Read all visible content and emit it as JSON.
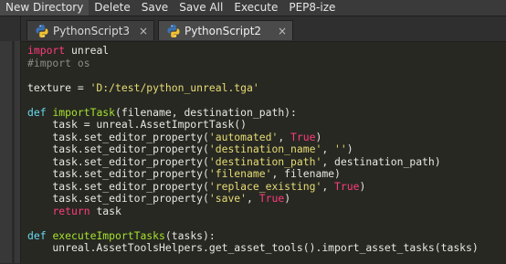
{
  "toolbar": {
    "items": [
      "New Directory",
      "Delete",
      "Save",
      "Save All",
      "Execute",
      "PEP8-ize"
    ]
  },
  "tabs": [
    {
      "label": "PythonScript3",
      "active": false,
      "close": "×"
    },
    {
      "label": "PythonScript2",
      "active": true,
      "close": "×"
    }
  ],
  "colors": {
    "keyword": "#ff3b7e",
    "string": "#e6db74",
    "comment": "#8b8b84",
    "def_keyword": "#66d9ef",
    "function_name": "#a6e22e",
    "editor_bg": "#272822",
    "default_text": "#e8e8e2"
  },
  "code": {
    "lines": [
      [
        [
          "kw",
          "import"
        ],
        [
          "t",
          " unreal"
        ]
      ],
      [
        [
          "com",
          "#import os"
        ]
      ],
      [],
      [
        [
          "t",
          "texture = "
        ],
        [
          "str",
          "'D:/test/python_unreal.tga'"
        ]
      ],
      [],
      [
        [
          "def",
          "def"
        ],
        [
          "t",
          " "
        ],
        [
          "fn",
          "importTask"
        ],
        [
          "t",
          "(filename, destination_path):"
        ]
      ],
      [
        [
          "t",
          "    task = unreal.AssetImportTask()"
        ]
      ],
      [
        [
          "t",
          "    task.set_editor_property("
        ],
        [
          "str",
          "'automated'"
        ],
        [
          "t",
          ", "
        ],
        [
          "bool",
          "True"
        ],
        [
          "t",
          ")"
        ]
      ],
      [
        [
          "t",
          "    task.set_editor_property("
        ],
        [
          "str",
          "'destination_name'"
        ],
        [
          "t",
          ", "
        ],
        [
          "str",
          "''"
        ],
        [
          "t",
          ")"
        ]
      ],
      [
        [
          "t",
          "    task.set_editor_property("
        ],
        [
          "str",
          "'destination_path'"
        ],
        [
          "t",
          ", destination_path)"
        ]
      ],
      [
        [
          "t",
          "    task.set_editor_property("
        ],
        [
          "str",
          "'filename'"
        ],
        [
          "t",
          ", filename)"
        ]
      ],
      [
        [
          "t",
          "    task.set_editor_property("
        ],
        [
          "str",
          "'replace_existing'"
        ],
        [
          "t",
          ", "
        ],
        [
          "bool",
          "True"
        ],
        [
          "t",
          ")"
        ]
      ],
      [
        [
          "t",
          "    task.set_editor_property("
        ],
        [
          "str",
          "'save'"
        ],
        [
          "t",
          ", "
        ],
        [
          "bool",
          "True"
        ],
        [
          "t",
          ")"
        ]
      ],
      [
        [
          "t",
          "    "
        ],
        [
          "kw",
          "return"
        ],
        [
          "t",
          " task"
        ]
      ],
      [],
      [
        [
          "def",
          "def"
        ],
        [
          "t",
          " "
        ],
        [
          "fn",
          "executeImportTasks"
        ],
        [
          "t",
          "(tasks):"
        ]
      ],
      [
        [
          "t",
          "    unreal.AssetToolsHelpers.get_asset_tools().import_asset_tasks(tasks)"
        ]
      ]
    ]
  }
}
